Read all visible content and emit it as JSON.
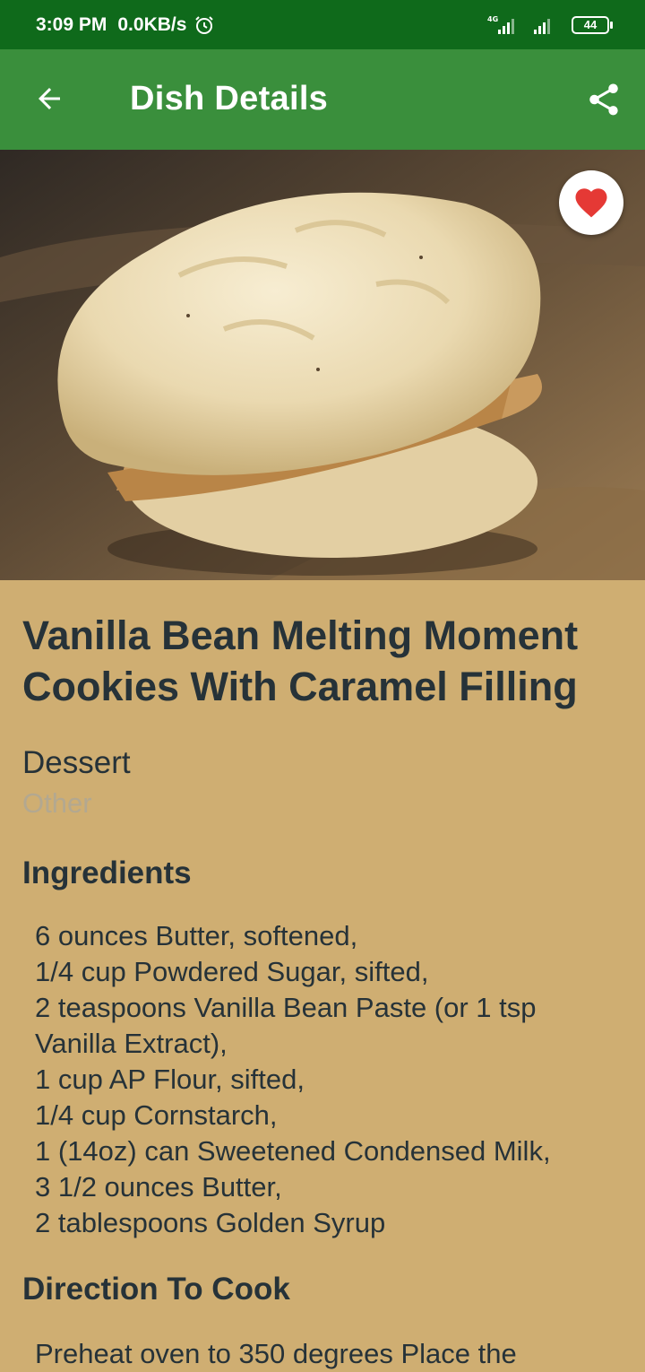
{
  "status_bar": {
    "time": "3:09 PM",
    "speed": "0.0KB/s",
    "battery": "44",
    "network": "4G"
  },
  "app_bar": {
    "title": "Dish Details",
    "back_icon": "arrow-back-icon",
    "share_icon": "share-icon"
  },
  "dish": {
    "title": "Vanilla Bean Melting Moment Cookies With Caramel Filling",
    "category": "Dessert",
    "area": "Other",
    "ingredients_heading": "Ingredients",
    "ingredients": [
      "6 ounces Butter, softened,",
      "1/4 cup Powdered Sugar, sifted,",
      "2 teaspoons Vanilla Bean Paste (or 1 tsp Vanilla Extract),",
      "1 cup AP Flour, sifted,",
      "1/4 cup Cornstarch,",
      "1 (14oz) can Sweetened Condensed Milk,",
      "3 1/2 ounces Butter,",
      "2 tablespoons Golden Syrup"
    ],
    "directions_heading": "Direction To Cook",
    "directions": "Preheat oven to 350 degrees Place the"
  },
  "colors": {
    "status_bar": "#0f6a1b",
    "app_bar": "#3a8f3c",
    "background": "#cfae72",
    "favorite": "#e53935"
  }
}
